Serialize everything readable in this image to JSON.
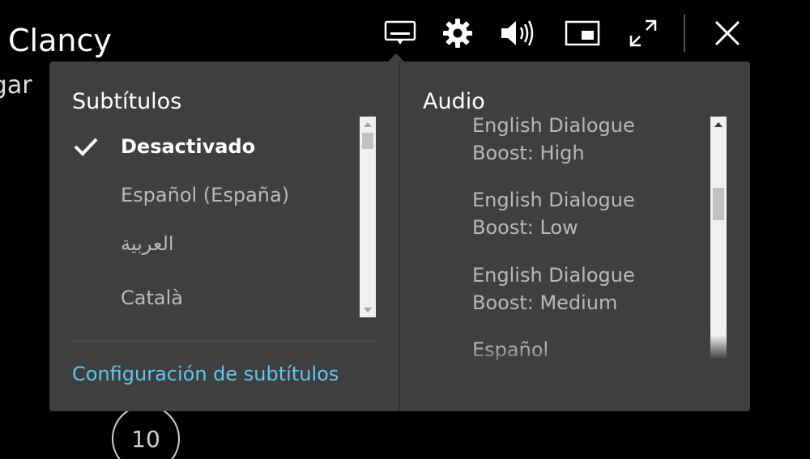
{
  "background": {
    "title": "Clancy",
    "subtitle": "rgar",
    "replay_seconds": "10"
  },
  "toolbar": {
    "buttons": [
      {
        "name": "subtitles-icon"
      },
      {
        "name": "gear-icon"
      },
      {
        "name": "volume-icon"
      },
      {
        "name": "picture-in-picture-icon"
      },
      {
        "name": "fullscreen-icon"
      },
      {
        "name": "close-icon"
      }
    ]
  },
  "subtitles": {
    "title": "Subtítulos",
    "items": [
      {
        "label": "Desactivado",
        "selected": true
      },
      {
        "label": "Español (España)",
        "selected": false
      },
      {
        "label": "العربية",
        "selected": false
      },
      {
        "label": "Català",
        "selected": false
      }
    ],
    "settings_link": "Configuración de subtítulos"
  },
  "audio": {
    "title": "Audio",
    "items": [
      {
        "line1": "English Dialogue",
        "line2": "Boost: High"
      },
      {
        "line1": "English Dialogue",
        "line2": "Boost: Low"
      },
      {
        "line1": "English Dialogue",
        "line2": "Boost: Medium"
      },
      {
        "line1": "Español",
        "line2": ""
      }
    ]
  },
  "colors": {
    "panel_bg": "#3f3f3f",
    "link": "#5fc8f0",
    "text_selected": "#ffffff",
    "text_normal": "#b9b9b9"
  }
}
